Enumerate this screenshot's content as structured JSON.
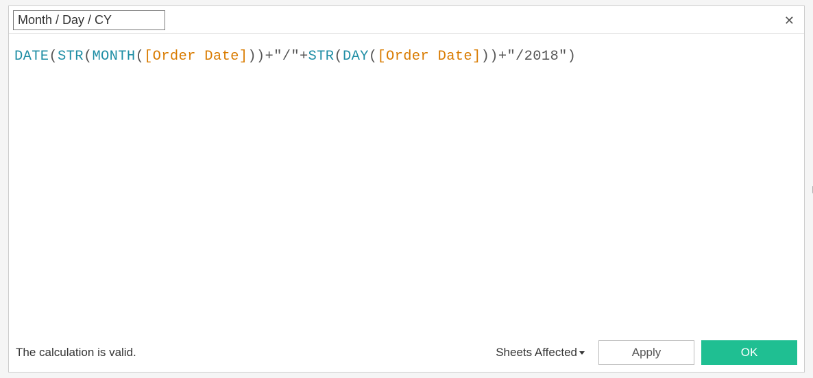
{
  "field_name": "Month / Day / CY",
  "formula": {
    "tokens": [
      {
        "text": "DATE",
        "type": "func"
      },
      {
        "text": "(",
        "type": "punct"
      },
      {
        "text": "STR",
        "type": "func"
      },
      {
        "text": "(",
        "type": "punct"
      },
      {
        "text": "MONTH",
        "type": "func"
      },
      {
        "text": "(",
        "type": "punct"
      },
      {
        "text": "[Order Date]",
        "type": "field"
      },
      {
        "text": "))+",
        "type": "punct"
      },
      {
        "text": "\"/\"",
        "type": "str"
      },
      {
        "text": "+",
        "type": "punct"
      },
      {
        "text": "STR",
        "type": "func"
      },
      {
        "text": "(",
        "type": "punct"
      },
      {
        "text": "DAY",
        "type": "func"
      },
      {
        "text": "(",
        "type": "punct"
      },
      {
        "text": "[Order Date]",
        "type": "field"
      },
      {
        "text": "))+",
        "type": "punct"
      },
      {
        "text": "\"/2018\"",
        "type": "str"
      },
      {
        "text": ")",
        "type": "punct"
      }
    ]
  },
  "status_text": "The calculation is valid.",
  "sheets_affected_label": "Sheets Affected",
  "apply_label": "Apply",
  "ok_label": "OK",
  "close_glyph": "✕",
  "expand_glyph": "▶"
}
